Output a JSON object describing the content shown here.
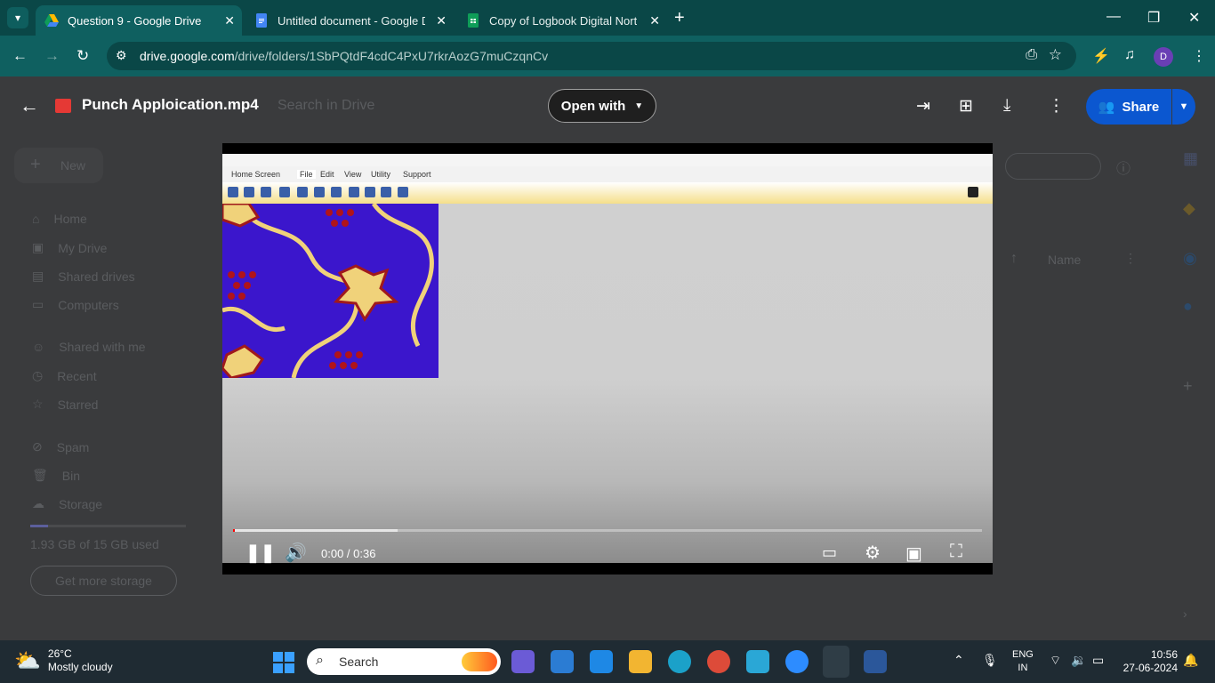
{
  "browser": {
    "tabs": [
      {
        "title": "Question 9 - Google Drive",
        "active": true
      },
      {
        "title": "Untitled document - Google Do",
        "active": false
      },
      {
        "title": "Copy of Logbook Digital North",
        "active": false
      }
    ],
    "url_host": "drive.google.com",
    "url_path": "/drive/folders/1SbPQtdF4cdC4PxU7rkrAozG7muCzqnCv",
    "profile_initial": "D"
  },
  "viewer": {
    "file_name": "Punch Apploication.mp4",
    "open_with_label": "Open with",
    "share_label": "Share"
  },
  "drive_bg": {
    "search_placeholder": "Search in Drive",
    "new_label": "New",
    "nav": [
      "Home",
      "My Drive",
      "Shared drives",
      "Computers",
      "Shared with me",
      "Recent",
      "Starred",
      "Spam",
      "Bin",
      "Storage"
    ],
    "storage_text": "1.93 GB of 15 GB used",
    "get_more_label": "Get more storage",
    "sort_label": "Name"
  },
  "video": {
    "time": "0:00 / 0:36",
    "progress_fraction": 0.0,
    "buffered_fraction": 0.22,
    "app_menu": [
      "Home Screen",
      "File",
      "Edit",
      "View",
      "Utility",
      "Support"
    ]
  },
  "taskbar": {
    "weather_temp": "26°C",
    "weather_desc": "Mostly cloudy",
    "search_label": "Search",
    "lang_top": "ENG",
    "lang_bottom": "IN",
    "time": "10:56",
    "date": "27-06-2024"
  },
  "colors": {
    "accent": "#0b57d0",
    "browser_frame": "#0a4747"
  }
}
